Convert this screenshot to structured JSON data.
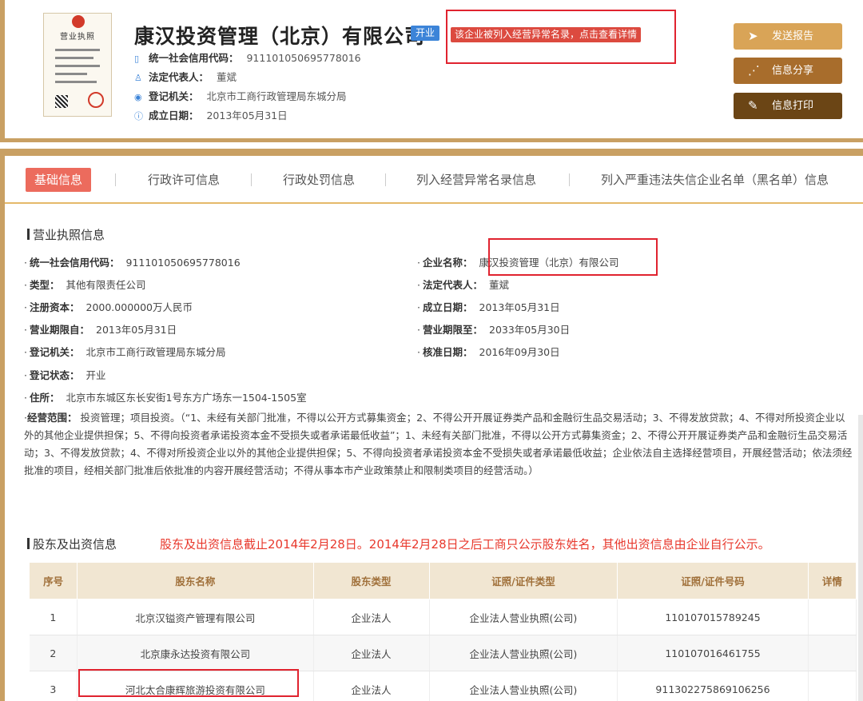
{
  "header": {
    "license_thumb_title": "营业执照",
    "company_name": "康汉投资管理（北京）有限公司",
    "status_badge": "开业",
    "abnormal_alert": "该企业被列入经营异常名录，点击查看详情",
    "credit_code_label": "统一社会信用代码：",
    "credit_code": "911101050695778016",
    "legal_rep_label": "法定代表人：",
    "legal_rep": "董斌",
    "reg_authority_label": "登记机关：",
    "reg_authority": "北京市工商行政管理局东城分局",
    "established_label": "成立日期：",
    "established": "2013年05月31日",
    "buttons": {
      "send_report": "发送报告",
      "share": "信息分享",
      "print": "信息打印"
    }
  },
  "tabs": [
    {
      "label": "基础信息",
      "active": true
    },
    {
      "label": "行政许可信息"
    },
    {
      "label": "行政处罚信息"
    },
    {
      "label": "列入经营异常名录信息"
    },
    {
      "label": "列入严重违法失信企业名单（黑名单）信息"
    }
  ],
  "license_section": {
    "title": "营业执照信息",
    "fields": {
      "credit_code_label": "统一社会信用代码：",
      "credit_code": "911101050695778016",
      "company_name_label": "企业名称：",
      "company_name": "康汉投资管理（北京）有限公司",
      "type_label": "类型：",
      "type": "其他有限责任公司",
      "legal_rep_label": "法定代表人：",
      "legal_rep": "董斌",
      "capital_label": "注册资本：",
      "capital": "2000.000000万人民币",
      "established_label": "成立日期：",
      "established": "2013年05月31日",
      "term_from_label": "营业期限自：",
      "term_from": "2013年05月31日",
      "term_to_label": "营业期限至：",
      "term_to": "2033年05月30日",
      "authority_label": "登记机关：",
      "authority": "北京市工商行政管理局东城分局",
      "approved_label": "核准日期：",
      "approved": "2016年09月30日",
      "reg_status_label": "登记状态：",
      "reg_status": "开业",
      "address_label": "住所：",
      "address": "北京市东城区东长安街1号东方广场东一1504-1505室",
      "scope_label": "经营范围：",
      "scope": "投资管理；项目投资。（“1、未经有关部门批准，不得以公开方式募集资金；2、不得公开开展证券类产品和金融衍生品交易活动；3、不得发放贷款；4、不得对所投资企业以外的其他企业提供担保；5、不得向投资者承诺投资本金不受损失或者承诺最低收益”；1、未经有关部门批准，不得以公开方式募集资金；2、不得公开开展证券类产品和金融衍生品交易活动；3、不得发放贷款；4、不得对所投资企业以外的其他企业提供担保；5、不得向投资者承诺投资本金不受损失或者承诺最低收益；企业依法自主选择经营项目，开展经营活动；依法须经批准的项目，经相关部门批准后依批准的内容开展经营活动；不得从事本市产业政策禁止和限制类项目的经营活动。）"
    }
  },
  "shareholder_section": {
    "title": "股东及出资信息",
    "note": "股东及出资信息截止2014年2月28日。2014年2月28日之后工商只公示股东姓名，其他出资信息由企业自行公示。",
    "columns": [
      "序号",
      "股东名称",
      "股东类型",
      "证照/证件类型",
      "证照/证件号码",
      "详情"
    ],
    "rows": [
      {
        "no": "1",
        "name": "北京汉镒资产管理有限公司",
        "type": "企业法人",
        "id_type": "企业法人营业执照(公司)",
        "id_no": "110107015789245",
        "detail": ""
      },
      {
        "no": "2",
        "name": "北京康永达投资有限公司",
        "type": "企业法人",
        "id_type": "企业法人营业执照(公司)",
        "id_no": "110107016461755",
        "detail": ""
      },
      {
        "no": "3",
        "name": "河北太合康辉旅游投资有限公司",
        "type": "企业法人",
        "id_type": "企业法人营业执照(公司)",
        "id_no": "911302275869106256",
        "detail": ""
      }
    ]
  },
  "colors": {
    "gold_border": "#c9a063",
    "tab_active": "#ec6b5d",
    "alert_red": "#e0232f",
    "badge_blue": "#3c84d8"
  }
}
